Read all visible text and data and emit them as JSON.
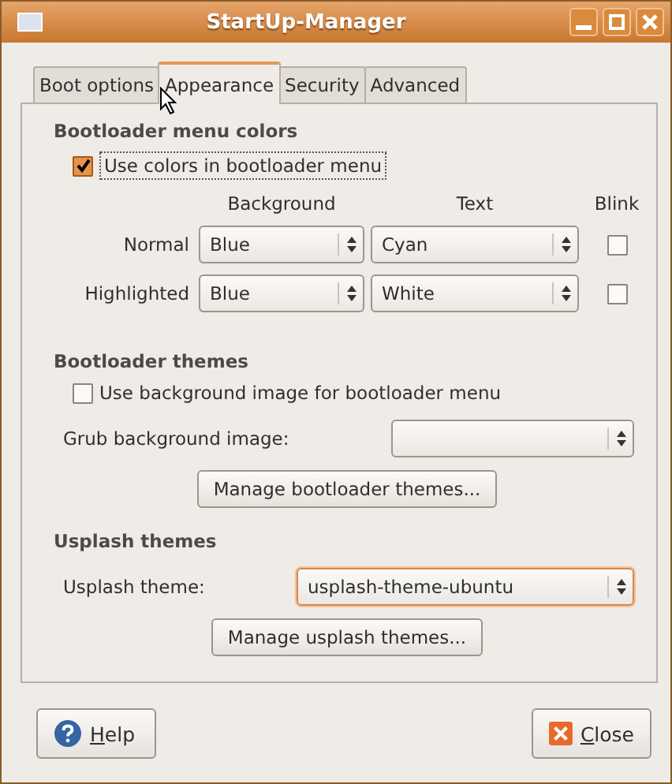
{
  "window": {
    "title": "StartUp-Manager"
  },
  "tabs": [
    {
      "label": "Boot options",
      "selected": false
    },
    {
      "label": "Appearance",
      "selected": true
    },
    {
      "label": "Security",
      "selected": false
    },
    {
      "label": "Advanced",
      "selected": false
    }
  ],
  "colors": {
    "heading": "Bootloader menu colors",
    "use_colors": {
      "label": "Use colors in bootloader menu",
      "checked": true
    },
    "columns": [
      "Background",
      "Text",
      "Blink"
    ],
    "rows": [
      {
        "label": "Normal",
        "background": "Blue",
        "text": "Cyan",
        "blink": false
      },
      {
        "label": "Highlighted",
        "background": "Blue",
        "text": "White",
        "blink": false
      }
    ]
  },
  "themes": {
    "heading": "Bootloader themes",
    "use_image": {
      "label": "Use background image for bootloader menu",
      "checked": false
    },
    "image_label": "Grub background image:",
    "manage_button": "Manage bootloader themes..."
  },
  "usplash": {
    "heading": "Usplash themes",
    "theme_label": "Usplash theme:",
    "theme_value": "usplash-theme-ubuntu",
    "focused": true,
    "manage_button": "Manage usplash themes..."
  },
  "buttons": [
    {
      "label": "Help",
      "kind": "help"
    },
    {
      "label": "Close",
      "kind": "close"
    }
  ]
}
